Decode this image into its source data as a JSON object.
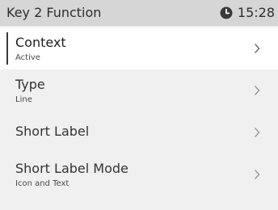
{
  "header": {
    "title": "Key 2 Function",
    "time": "15:28",
    "status_icon": "clock-icon"
  },
  "menu": {
    "items": [
      {
        "label": "Context",
        "value": "Active",
        "selected": true,
        "icon": "chevron-right-icon"
      },
      {
        "label": "Type",
        "value": "Line",
        "selected": false,
        "icon": "chevron-right-icon"
      },
      {
        "label": "Short Label",
        "value": "",
        "selected": false,
        "icon": "chevron-right-icon"
      },
      {
        "label": "Short Label Mode",
        "value": "Icon and Text",
        "selected": false,
        "icon": "chevron-right-icon"
      }
    ]
  },
  "colors": {
    "header_bg": "#d6d6d6",
    "list_bg": "#f0f0f0",
    "selected_bg": "#ffffff",
    "text": "#333333"
  }
}
